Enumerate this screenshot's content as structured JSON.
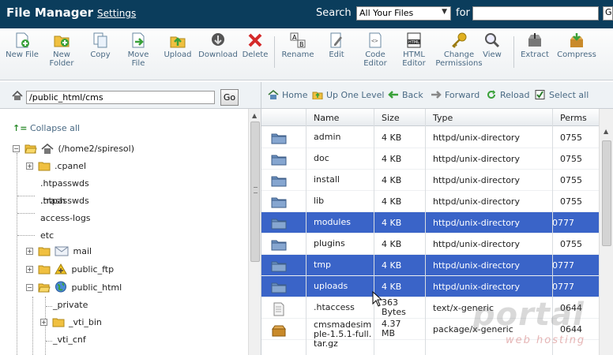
{
  "header": {
    "app_title": "File Manager",
    "settings_label": "Settings",
    "search_label": "Search",
    "search_scope": "All Your Files",
    "for_label": "for",
    "search_value": "",
    "go_label": "Go"
  },
  "toolbar": {
    "items": [
      {
        "label": "New File",
        "icon": "new-file-icon"
      },
      {
        "label": "New Folder",
        "icon": "new-folder-icon"
      },
      {
        "label": "Copy",
        "icon": "copy-icon"
      },
      {
        "label": "Move File",
        "icon": "move-file-icon"
      },
      {
        "label": "Upload",
        "icon": "upload-icon"
      },
      {
        "label": "Download",
        "icon": "download-icon"
      },
      {
        "label": "Delete",
        "icon": "delete-icon"
      },
      {
        "label": "Rename",
        "icon": "rename-icon"
      },
      {
        "label": "Edit",
        "icon": "edit-icon"
      },
      {
        "label": "Code Editor",
        "icon": "code-editor-icon"
      },
      {
        "label": "HTML Editor",
        "icon": "html-editor-icon"
      },
      {
        "label": "Change Permissions",
        "icon": "permissions-icon"
      },
      {
        "label": "View",
        "icon": "view-icon"
      },
      {
        "label": "Extract",
        "icon": "extract-icon"
      },
      {
        "label": "Compress",
        "icon": "compress-icon"
      }
    ]
  },
  "path_bar": {
    "path": "/public_html/cms",
    "go_label": "Go"
  },
  "nav": {
    "home": "Home",
    "up_one_level": "Up One Level",
    "back": "Back",
    "forward": "Forward",
    "reload": "Reload",
    "select_all": "Select all"
  },
  "tree": {
    "collapse_all": "Collapse all",
    "root": "(/home2/spiresol)",
    "items": [
      ".cpanel",
      ".htpasswds",
      ".trash",
      "access-logs",
      "etc",
      "mail",
      "public_ftp",
      "public_html",
      "_private",
      "_vti_bin",
      "_vti_cnf"
    ]
  },
  "table": {
    "columns": [
      "Name",
      "Size",
      "Type",
      "Perms"
    ],
    "rows": [
      {
        "name": "admin",
        "size": "4 KB",
        "type": "httpd/unix-directory",
        "perms": "0755",
        "selected": false,
        "kind": "folder"
      },
      {
        "name": "doc",
        "size": "4 KB",
        "type": "httpd/unix-directory",
        "perms": "0755",
        "selected": false,
        "kind": "folder"
      },
      {
        "name": "install",
        "size": "4 KB",
        "type": "httpd/unix-directory",
        "perms": "0755",
        "selected": false,
        "kind": "folder"
      },
      {
        "name": "lib",
        "size": "4 KB",
        "type": "httpd/unix-directory",
        "perms": "0755",
        "selected": false,
        "kind": "folder"
      },
      {
        "name": "modules",
        "size": "4 KB",
        "type": "httpd/unix-directory",
        "perms": "0777",
        "selected": true,
        "kind": "folder"
      },
      {
        "name": "plugins",
        "size": "4 KB",
        "type": "httpd/unix-directory",
        "perms": "0755",
        "selected": false,
        "kind": "folder"
      },
      {
        "name": "tmp",
        "size": "4 KB",
        "type": "httpd/unix-directory",
        "perms": "0777",
        "selected": true,
        "kind": "folder"
      },
      {
        "name": "uploads",
        "size": "4 KB",
        "type": "httpd/unix-directory",
        "perms": "0777",
        "selected": true,
        "kind": "folder"
      },
      {
        "name": ".htaccess",
        "size": "363 Bytes",
        "type": "text/x-generic",
        "perms": "0644",
        "selected": false,
        "kind": "text"
      },
      {
        "name": "cmsmadesimple-1.5.1-full.tar.gz",
        "size": "4.37 MB",
        "type": "package/x-generic",
        "perms": "0644",
        "selected": false,
        "kind": "package"
      }
    ]
  },
  "colors": {
    "title_bar": "#0b3d5c",
    "selection": "#3a64c8",
    "link": "#4a6a84"
  },
  "watermark": {
    "brand": "portal",
    "tagline": "web hosting"
  }
}
